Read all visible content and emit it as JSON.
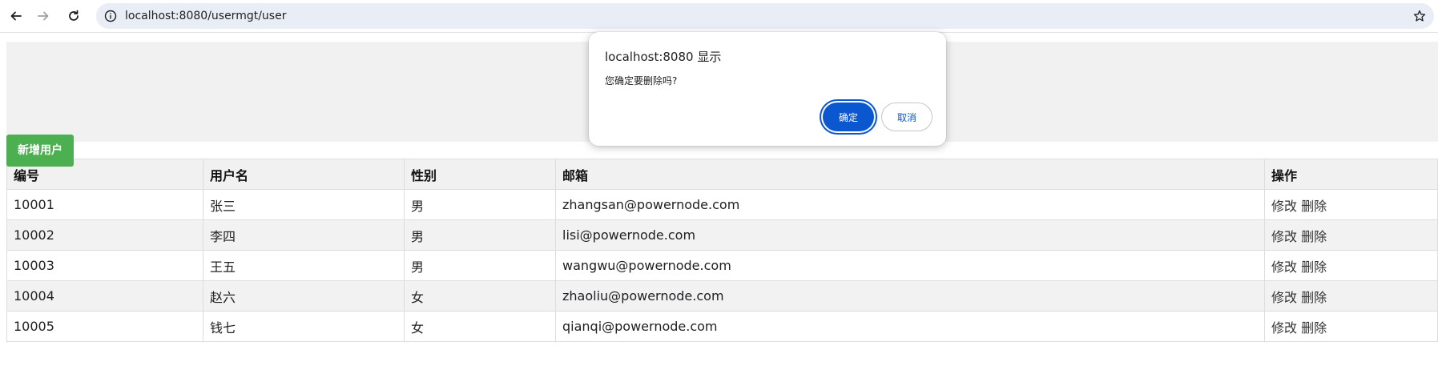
{
  "browser": {
    "url": "localhost:8080/usermgt/user",
    "icons": [
      "back-icon",
      "forward-icon",
      "reload-icon",
      "info-icon",
      "star-icon"
    ]
  },
  "page": {
    "add_button_label": "新增用户",
    "accent_color": "#4caf50",
    "table": {
      "headers": [
        "编号",
        "用户名",
        "性别",
        "邮箱",
        "操作"
      ],
      "rows": [
        {
          "id": "10001",
          "name": "张三",
          "gender": "男",
          "email": "zhangsan@powernode.com",
          "edit": "修改",
          "delete": "删除"
        },
        {
          "id": "10002",
          "name": "李四",
          "gender": "男",
          "email": "lisi@powernode.com",
          "edit": "修改",
          "delete": "删除"
        },
        {
          "id": "10003",
          "name": "王五",
          "gender": "男",
          "email": "wangwu@powernode.com",
          "edit": "修改",
          "delete": "删除"
        },
        {
          "id": "10004",
          "name": "赵六",
          "gender": "女",
          "email": "zhaoliu@powernode.com",
          "edit": "修改",
          "delete": "删除"
        },
        {
          "id": "10005",
          "name": "钱七",
          "gender": "女",
          "email": "qianqi@powernode.com",
          "edit": "修改",
          "delete": "删除"
        }
      ]
    }
  },
  "dialog": {
    "title": "localhost:8080 显示",
    "message": "您确定要删除吗?",
    "ok_label": "确定",
    "cancel_label": "取消",
    "primary_color": "#0b57d0"
  }
}
